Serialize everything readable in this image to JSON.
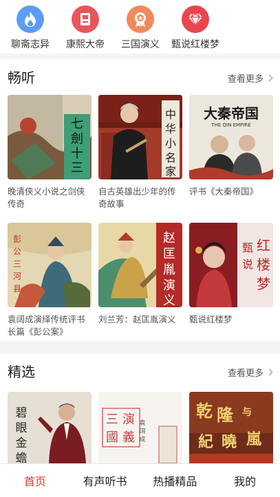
{
  "categories": [
    {
      "label": "聊斋志异",
      "icon": "fire-icon",
      "color": "#5b9df5"
    },
    {
      "label": "康熙大帝",
      "icon": "book-icon",
      "color": "#e9555a"
    },
    {
      "label": "三国演义",
      "icon": "medal-icon",
      "color": "#f08a5d"
    },
    {
      "label": "甄说红楼梦",
      "icon": "diamond-icon",
      "color": "#e9454d"
    }
  ],
  "listen": {
    "title": "畅听",
    "more": "查看更多",
    "items": [
      {
        "title": "晚清侠义小说之剑侠传奇",
        "cover_text": "七剑十三侠"
      },
      {
        "title": "自古英雄出少年的传奇故事",
        "cover_text": "中华小名家"
      },
      {
        "title": "评书《大秦帝国》",
        "cover_text": "大秦帝国",
        "cover_sub": "THE QIN EMPIRE"
      },
      {
        "title": "袁阔成演绎传统评书长篇《彭公案》",
        "cover_text": "彭公三河县"
      },
      {
        "title": "刘兰芳：赵匡胤演义",
        "cover_text": "赵匡胤演义"
      },
      {
        "title": "甄说红楼梦",
        "cover_text": "红楼梦",
        "cover_sub": "甄说"
      }
    ]
  },
  "selected": {
    "title": "精选",
    "more": "查看更多",
    "items": [
      {
        "cover_text": "碧眼金蟾"
      },
      {
        "cover_text": "三国演义",
        "cover_sub": "袁阔成"
      },
      {
        "cover_text": "乾隆与纪晓岚"
      }
    ]
  },
  "tabs": [
    {
      "label": "首页",
      "active": true
    },
    {
      "label": "有声听书",
      "active": false
    },
    {
      "label": "热播精品",
      "active": false
    },
    {
      "label": "我的",
      "active": false
    }
  ],
  "colors": {
    "accent": "#e23b2f"
  }
}
